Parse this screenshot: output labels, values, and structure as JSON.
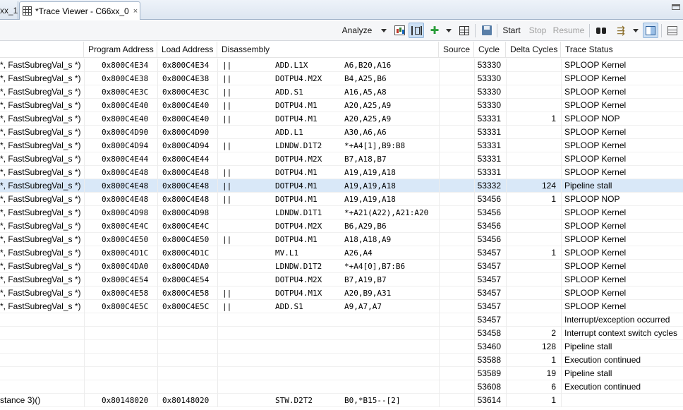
{
  "tabs": {
    "inactive_label": "xx_1",
    "active_label": "*Trace Viewer - C66xx_0",
    "close_glyph": "×"
  },
  "toolbar": {
    "analyze_label": "Analyze",
    "start_label": "Start",
    "stop_label": "Stop",
    "resume_label": "Resume"
  },
  "columns": {
    "program_address": "Program Address",
    "load_address": "Load Address",
    "disassembly": "Disassembly",
    "source": "Source",
    "cycle": "Cycle",
    "delta_cycles": "Delta Cycles",
    "trace_status": "Trace Status"
  },
  "rows": [
    {
      "func": "*, FastSubregVal_s *)",
      "prog": "0x800C4E34",
      "load": "0x800C4E34",
      "par": "||",
      "op": "ADD.L1X",
      "args": "A6,B20,A16",
      "cycle": "53330",
      "delta": "",
      "status": "SPLOOP Kernel",
      "selected": false
    },
    {
      "func": "*, FastSubregVal_s *)",
      "prog": "0x800C4E38",
      "load": "0x800C4E38",
      "par": "||",
      "op": "DOTPU4.M2X",
      "args": "B4,A25,B6",
      "cycle": "53330",
      "delta": "",
      "status": "SPLOOP Kernel",
      "selected": false
    },
    {
      "func": "*, FastSubregVal_s *)",
      "prog": "0x800C4E3C",
      "load": "0x800C4E3C",
      "par": "||",
      "op": "ADD.S1",
      "args": "A16,A5,A8",
      "cycle": "53330",
      "delta": "",
      "status": "SPLOOP Kernel",
      "selected": false
    },
    {
      "func": "*, FastSubregVal_s *)",
      "prog": "0x800C4E40",
      "load": "0x800C4E40",
      "par": "||",
      "op": "DOTPU4.M1",
      "args": "A20,A25,A9",
      "cycle": "53330",
      "delta": "",
      "status": "SPLOOP Kernel",
      "selected": false
    },
    {
      "func": "*, FastSubregVal_s *)",
      "prog": "0x800C4E40",
      "load": "0x800C4E40",
      "par": "||",
      "op": "DOTPU4.M1",
      "args": "A20,A25,A9",
      "cycle": "53331",
      "delta": "1",
      "status": "SPLOOP NOP",
      "selected": false
    },
    {
      "func": "*, FastSubregVal_s *)",
      "prog": "0x800C4D90",
      "load": "0x800C4D90",
      "par": "",
      "op": "ADD.L1",
      "args": "A30,A6,A6",
      "cycle": "53331",
      "delta": "",
      "status": "SPLOOP Kernel",
      "selected": false
    },
    {
      "func": "*, FastSubregVal_s *)",
      "prog": "0x800C4D94",
      "load": "0x800C4D94",
      "par": "||",
      "op": "LDNDW.D1T2",
      "args": "*+A4[1],B9:B8",
      "cycle": "53331",
      "delta": "",
      "status": "SPLOOP Kernel",
      "selected": false
    },
    {
      "func": "*, FastSubregVal_s *)",
      "prog": "0x800C4E44",
      "load": "0x800C4E44",
      "par": "",
      "op": "DOTPU4.M2X",
      "args": "B7,A18,B7",
      "cycle": "53331",
      "delta": "",
      "status": "SPLOOP Kernel",
      "selected": false
    },
    {
      "func": "*, FastSubregVal_s *)",
      "prog": "0x800C4E48",
      "load": "0x800C4E48",
      "par": "||",
      "op": "DOTPU4.M1",
      "args": "A19,A19,A18",
      "cycle": "53331",
      "delta": "",
      "status": "SPLOOP Kernel",
      "selected": false
    },
    {
      "func": "*, FastSubregVal_s *)",
      "prog": "0x800C4E48",
      "load": "0x800C4E48",
      "par": "||",
      "op": "DOTPU4.M1",
      "args": "A19,A19,A18",
      "cycle": "53332",
      "delta": "124",
      "status": "Pipeline stall",
      "selected": true
    },
    {
      "func": "*, FastSubregVal_s *)",
      "prog": "0x800C4E48",
      "load": "0x800C4E48",
      "par": "||",
      "op": "DOTPU4.M1",
      "args": "A19,A19,A18",
      "cycle": "53456",
      "delta": "1",
      "status": "SPLOOP NOP",
      "selected": false
    },
    {
      "func": "*, FastSubregVal_s *)",
      "prog": "0x800C4D98",
      "load": "0x800C4D98",
      "par": "",
      "op": "LDNDW.D1T1",
      "args": "*+A21(A22),A21:A20",
      "cycle": "53456",
      "delta": "",
      "status": "SPLOOP Kernel",
      "selected": false
    },
    {
      "func": "*, FastSubregVal_s *)",
      "prog": "0x800C4E4C",
      "load": "0x800C4E4C",
      "par": "",
      "op": "DOTPU4.M2X",
      "args": "B6,A29,B6",
      "cycle": "53456",
      "delta": "",
      "status": "SPLOOP Kernel",
      "selected": false
    },
    {
      "func": "*, FastSubregVal_s *)",
      "prog": "0x800C4E50",
      "load": "0x800C4E50",
      "par": "||",
      "op": "DOTPU4.M1",
      "args": "A18,A18,A9",
      "cycle": "53456",
      "delta": "",
      "status": "SPLOOP Kernel",
      "selected": false
    },
    {
      "func": "*, FastSubregVal_s *)",
      "prog": "0x800C4D1C",
      "load": "0x800C4D1C",
      "par": "",
      "op": "MV.L1",
      "args": "A26,A4",
      "cycle": "53457",
      "delta": "1",
      "status": "SPLOOP Kernel",
      "selected": false
    },
    {
      "func": "*, FastSubregVal_s *)",
      "prog": "0x800C4DA0",
      "load": "0x800C4DA0",
      "par": "",
      "op": "LDNDW.D1T2",
      "args": "*+A4[0],B7:B6",
      "cycle": "53457",
      "delta": "",
      "status": "SPLOOP Kernel",
      "selected": false
    },
    {
      "func": "*, FastSubregVal_s *)",
      "prog": "0x800C4E54",
      "load": "0x800C4E54",
      "par": "",
      "op": "DOTPU4.M2X",
      "args": "B7,A19,B7",
      "cycle": "53457",
      "delta": "",
      "status": "SPLOOP Kernel",
      "selected": false
    },
    {
      "func": "*, FastSubregVal_s *)",
      "prog": "0x800C4E58",
      "load": "0x800C4E58",
      "par": "||",
      "op": "DOTPU4.M1X",
      "args": "A20,B9,A31",
      "cycle": "53457",
      "delta": "",
      "status": "SPLOOP Kernel",
      "selected": false
    },
    {
      "func": "*, FastSubregVal_s *)",
      "prog": "0x800C4E5C",
      "load": "0x800C4E5C",
      "par": "||",
      "op": "ADD.S1",
      "args": "A9,A7,A7",
      "cycle": "53457",
      "delta": "",
      "status": "SPLOOP Kernel",
      "selected": false
    },
    {
      "func": "",
      "prog": "",
      "load": "",
      "par": "",
      "op": "",
      "args": "",
      "cycle": "53457",
      "delta": "",
      "status": "Interrupt/exception occurred",
      "selected": false
    },
    {
      "func": "",
      "prog": "",
      "load": "",
      "par": "",
      "op": "",
      "args": "",
      "cycle": "53458",
      "delta": "2",
      "status": "Interrupt context switch cycles",
      "selected": false
    },
    {
      "func": "",
      "prog": "",
      "load": "",
      "par": "",
      "op": "",
      "args": "",
      "cycle": "53460",
      "delta": "128",
      "status": "Pipeline stall",
      "selected": false
    },
    {
      "func": "",
      "prog": "",
      "load": "",
      "par": "",
      "op": "",
      "args": "",
      "cycle": "53588",
      "delta": "1",
      "status": "Execution continued",
      "selected": false
    },
    {
      "func": "",
      "prog": "",
      "load": "",
      "par": "",
      "op": "",
      "args": "",
      "cycle": "53589",
      "delta": "19",
      "status": "Pipeline stall",
      "selected": false
    },
    {
      "func": "",
      "prog": "",
      "load": "",
      "par": "",
      "op": "",
      "args": "",
      "cycle": "53608",
      "delta": "6",
      "status": "Execution continued",
      "selected": false
    },
    {
      "func": "stance 3)()",
      "prog": "0x80148020",
      "load": "0x80148020",
      "par": "",
      "op": "STW.D2T2",
      "args": "B0,*B15--[2]",
      "cycle": "53614",
      "delta": "1",
      "status": "",
      "selected": false
    }
  ]
}
